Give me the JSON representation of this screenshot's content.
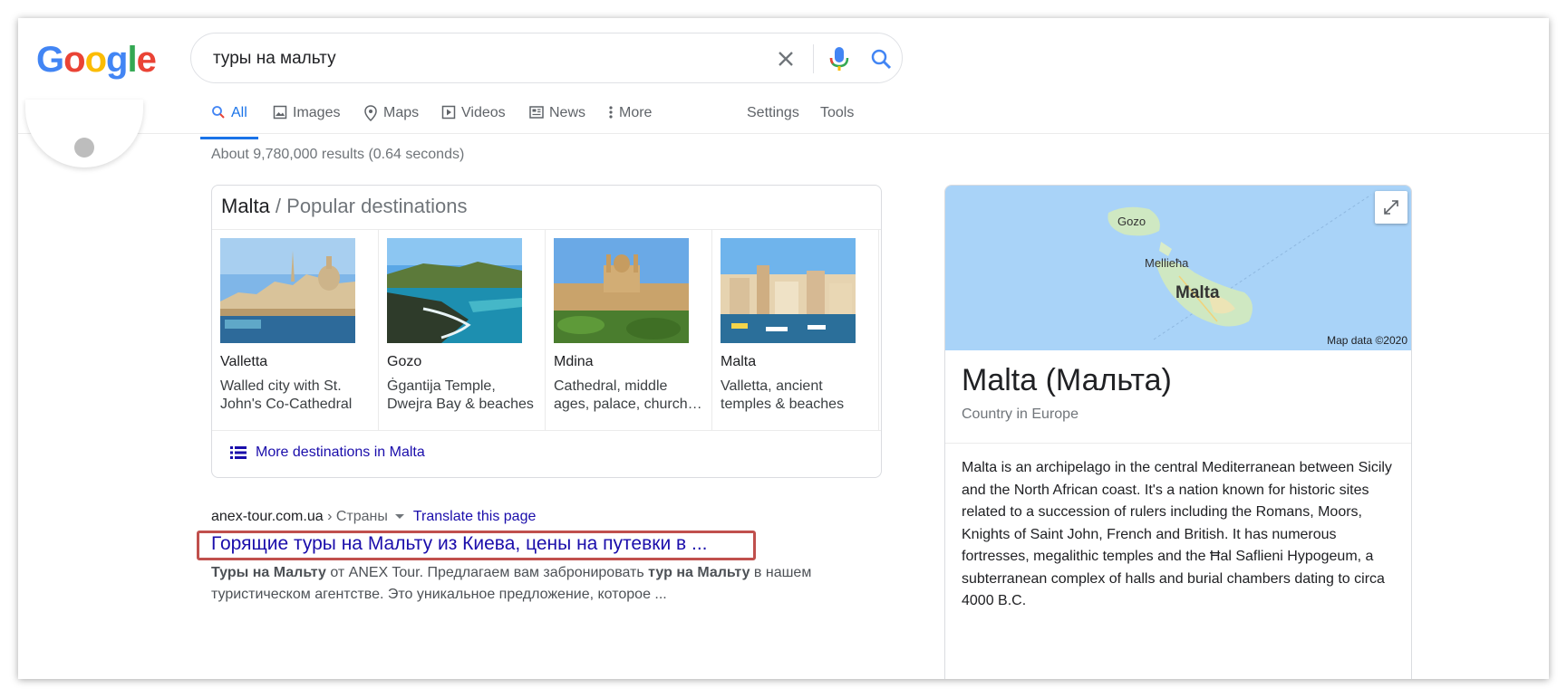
{
  "logo": {
    "letters": [
      "G",
      "o",
      "o",
      "g",
      "l",
      "e"
    ],
    "colors": [
      "#4285f4",
      "#ea4335",
      "#fbbc05",
      "#4285f4",
      "#34a853",
      "#ea4335"
    ]
  },
  "search": {
    "query": "туры на мальту",
    "clear_icon": "close-icon",
    "voice_icon": "microphone-icon",
    "submit_icon": "search-icon"
  },
  "tabs": [
    {
      "label": "All",
      "icon": "search-icon",
      "active": true
    },
    {
      "label": "Images",
      "icon": "image-icon",
      "active": false
    },
    {
      "label": "Maps",
      "icon": "map-pin-icon",
      "active": false
    },
    {
      "label": "Videos",
      "icon": "play-icon",
      "active": false
    },
    {
      "label": "News",
      "icon": "news-icon",
      "active": false
    },
    {
      "label": "More",
      "icon": "more-vert-icon",
      "active": false
    }
  ],
  "tools": {
    "settings": "Settings",
    "tools": "Tools"
  },
  "result_stats": "About 9,780,000 results (0.64 seconds)",
  "destinations": {
    "title": "Malta",
    "subtitle": "/ Popular destinations",
    "items": [
      {
        "name": "Valletta",
        "desc": "Walled city with St. John's Co-Cathedral"
      },
      {
        "name": "Gozo",
        "desc": "Ġgantija Temple, Dwejra Bay & beaches"
      },
      {
        "name": "Mdina",
        "desc": "Cathedral, middle ages, palace, church…"
      },
      {
        "name": "Malta",
        "desc": "Valletta, ancient temples & beaches"
      }
    ],
    "more_link": "More destinations in Malta"
  },
  "result": {
    "domain": "anex-tour.com.ua",
    "breadcrumb": "› Страны",
    "translate": "Translate this page",
    "title": "Горящие туры на Мальту из Киева, цены на путевки в ...",
    "snippet_bold1": "Туры на Мальту",
    "snippet_text1": " от ANEX Tour. Предлагаем вам забронировать ",
    "snippet_bold2": "тур на Мальту",
    "snippet_text2": " в нашем туристическом агентстве. Это уникальное предложение, которое ..."
  },
  "knowledge_panel": {
    "map_labels": {
      "gozo": "Gozo",
      "mellieha": "Mellieħa",
      "malta": "Malta"
    },
    "map_data": "Map data ©2020",
    "title": "Malta (Мальта)",
    "subtitle": "Country in Europe",
    "description": "Malta is an archipelago in the central Mediterranean between Sicily and the North African coast. It's a nation known for historic sites related to a succession of rulers including the Romans, Moors, Knights of Saint John, French and British. It has numerous fortresses, megalithic temples and the Ħal Saflieni Hypogeum, a subterranean complex of halls and burial chambers dating to circa 4000 B.C."
  }
}
